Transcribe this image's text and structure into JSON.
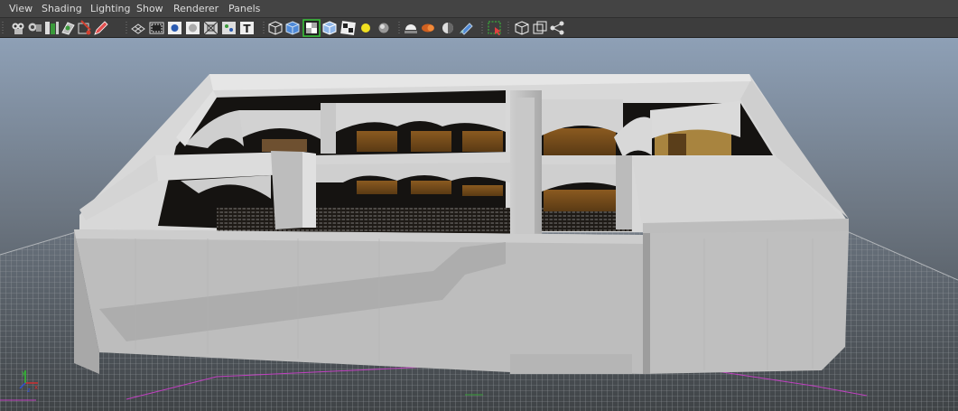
{
  "menu": {
    "view": "View",
    "shading": "Shading",
    "lighting": "Lighting",
    "show": "Show",
    "renderer": "Renderer",
    "panels": "Panels"
  },
  "toolbar_icons": [
    "select-camera-icon",
    "camera-attributes-icon",
    "bookmark-icon",
    "image-plane-icon",
    "2d-pan-zoom-icon",
    "grease-pencil-icon",
    "grid-icon",
    "film-gate-icon",
    "resolution-gate-icon",
    "gate-mask-icon",
    "field-chart-icon",
    "safe-action-icon",
    "safe-title-icon",
    "wireframe-icon",
    "smooth-shade-icon",
    "wireframe-on-shaded-icon",
    "default-material-icon",
    "textured-icon",
    "use-all-lights-icon",
    "shadows-icon",
    "screen-space-ao-icon",
    "motion-blur-icon",
    "anti-aliasing-icon",
    "isolate-select-icon",
    "xray-icon",
    "xray-joints-icon",
    "xray-components-icon"
  ],
  "colors": {
    "menubar_bg": "#444444",
    "toolbar_bg": "#3d3d3d",
    "viewport_gradient_top": "#8ea0b6",
    "viewport_gradient_bottom": "#3f4346",
    "grid_line": "#9aa0a6",
    "axis_x": "#d03030",
    "axis_y": "#30c030",
    "axis_z": "#3050d0",
    "active_icon_highlight": "#39c739"
  },
  "viewport": {
    "label": "perspective-viewport",
    "axis_labels": [
      "x",
      "y",
      "z"
    ]
  }
}
